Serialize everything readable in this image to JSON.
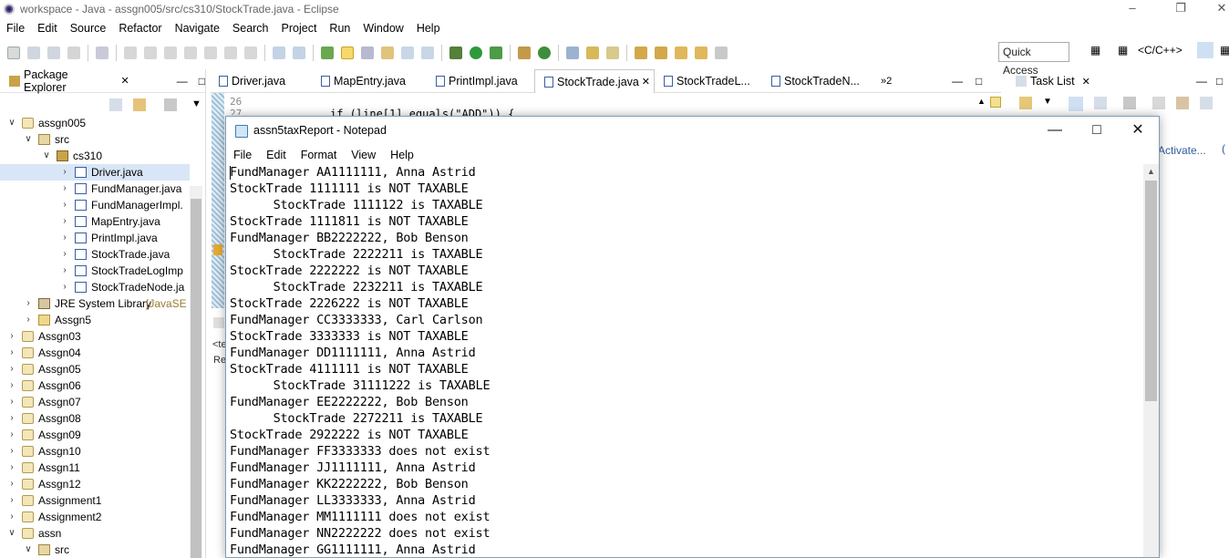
{
  "eclipse": {
    "title": "workspace - Java - assgn005/src/cs310/StockTrade.java - Eclipse",
    "menu": [
      "File",
      "Edit",
      "Source",
      "Refactor",
      "Navigate",
      "Search",
      "Project",
      "Run",
      "Window",
      "Help"
    ],
    "quick_access": "Quick Access",
    "perspective": "<C/C++>",
    "package_explorer_title": "Package Explorer",
    "task_list_title": "Task List",
    "task_list_link": "Activate...",
    "editor_tabs": [
      "Driver.java",
      "MapEntry.java",
      "PrintImpl.java",
      "StockTrade.java",
      "StockTradeL...",
      "StockTradeN...",
      "»2"
    ],
    "active_tab_index": 3,
    "line_numbers": [
      "26",
      "27"
    ],
    "code_line": "if (line[1].equals(\"ADD\")) {",
    "console_fragments": [
      "<te",
      "Re"
    ],
    "tree": [
      {
        "label": "assgn005",
        "type": "proj",
        "depth": 0,
        "expanded": true
      },
      {
        "label": "src",
        "type": "src",
        "depth": 1,
        "expanded": true
      },
      {
        "label": "cs310",
        "type": "pkg",
        "depth": 2,
        "expanded": true
      },
      {
        "label": "Driver.java",
        "type": "java",
        "depth": 3,
        "selected": true
      },
      {
        "label": "FundManager.java",
        "type": "java",
        "depth": 3
      },
      {
        "label": "FundManagerImpl.",
        "type": "java",
        "depth": 3
      },
      {
        "label": "MapEntry.java",
        "type": "java",
        "depth": 3
      },
      {
        "label": "PrintImpl.java",
        "type": "java",
        "depth": 3
      },
      {
        "label": "StockTrade.java",
        "type": "java",
        "depth": 3
      },
      {
        "label": "StockTradeLogImp",
        "type": "java",
        "depth": 3
      },
      {
        "label": "StockTradeNode.ja",
        "type": "java",
        "depth": 3
      },
      {
        "label": "JRE System Library",
        "suffix": "[JavaSE",
        "type": "lib",
        "depth": 1
      },
      {
        "label": "Assgn5",
        "type": "fold",
        "depth": 1
      },
      {
        "label": "Assgn03",
        "type": "proj",
        "depth": 0
      },
      {
        "label": "Assgn04",
        "type": "proj",
        "depth": 0
      },
      {
        "label": "Assgn05",
        "type": "proj",
        "depth": 0
      },
      {
        "label": "Assgn06",
        "type": "proj",
        "depth": 0
      },
      {
        "label": "Assgn07",
        "type": "proj",
        "depth": 0
      },
      {
        "label": "Assgn08",
        "type": "proj",
        "depth": 0
      },
      {
        "label": "Assgn09",
        "type": "proj",
        "depth": 0
      },
      {
        "label": "Assgn10",
        "type": "proj",
        "depth": 0
      },
      {
        "label": "Assgn11",
        "type": "proj",
        "depth": 0
      },
      {
        "label": "Assgn12",
        "type": "proj",
        "depth": 0
      },
      {
        "label": "Assignment1",
        "type": "proj",
        "depth": 0
      },
      {
        "label": "Assignment2",
        "type": "proj",
        "depth": 0
      },
      {
        "label": "assn",
        "type": "proj",
        "depth": 0,
        "expanded": true
      },
      {
        "label": "src",
        "type": "src",
        "depth": 1,
        "expanded": true
      }
    ]
  },
  "notepad": {
    "title": "assn5taxReport - Notepad",
    "menu": [
      "File",
      "Edit",
      "Format",
      "View",
      "Help"
    ],
    "lines": [
      "FundManager AA1111111, Anna Astrid",
      "StockTrade 1111111 is NOT TAXABLE",
      "      StockTrade 1111122 is TAXABLE",
      "StockTrade 1111811 is NOT TAXABLE",
      "FundManager BB2222222, Bob Benson",
      "      StockTrade 2222211 is TAXABLE",
      "StockTrade 2222222 is NOT TAXABLE",
      "      StockTrade 2232211 is TAXABLE",
      "StockTrade 2226222 is NOT TAXABLE",
      "FundManager CC3333333, Carl Carlson",
      "StockTrade 3333333 is NOT TAXABLE",
      "FundManager DD1111111, Anna Astrid",
      "StockTrade 4111111 is NOT TAXABLE",
      "      StockTrade 31111222 is TAXABLE",
      "FundManager EE2222222, Bob Benson",
      "      StockTrade 2272211 is TAXABLE",
      "StockTrade 2922222 is NOT TAXABLE",
      "FundManager FF3333333 does not exist",
      "FundManager JJ1111111, Anna Astrid",
      "FundManager KK2222222, Bob Benson",
      "FundManager LL3333333, Anna Astrid",
      "FundManager MM1111111 does not exist",
      "FundManager NN2222222 does not exist",
      "FundManager GG1111111, Anna Astrid"
    ]
  },
  "icons": {
    "close": "close-icon",
    "maximize": "maximize-icon",
    "minimize": "minimize-icon"
  }
}
